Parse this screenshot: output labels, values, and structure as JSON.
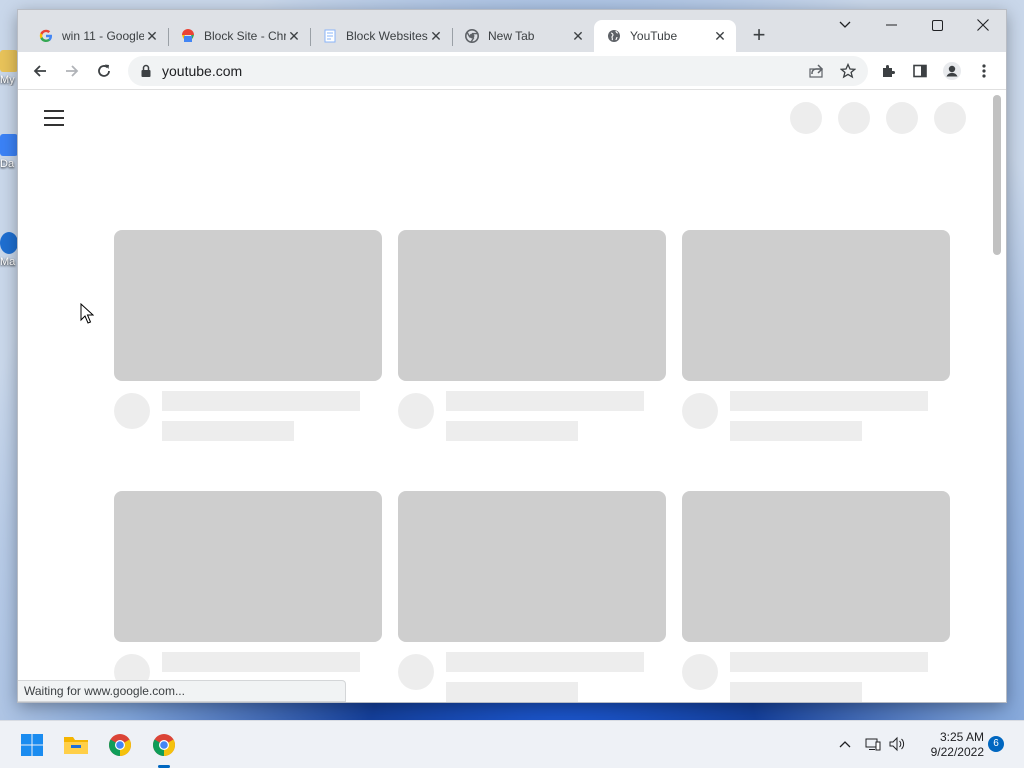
{
  "desktop": {
    "icons": [
      {
        "label": "My",
        "color": "#e8c35a"
      },
      {
        "label": "Da",
        "color": "#3b82f6"
      },
      {
        "label": "Ma",
        "color": "#1f6fd1"
      }
    ]
  },
  "browser": {
    "tabs": [
      {
        "title": "win 11 - Google",
        "icon": "google-icon",
        "active": false
      },
      {
        "title": "Block Site - Chrome",
        "icon": "chrome-webstore-icon",
        "active": false
      },
      {
        "title": "Block Websites",
        "icon": "page-icon",
        "active": false
      },
      {
        "title": "New Tab",
        "icon": "chrome-icon",
        "active": false
      },
      {
        "title": "YouTube",
        "icon": "globe-icon",
        "active": true
      }
    ],
    "new_tab_label": "+",
    "address": {
      "url": "youtube.com"
    },
    "status_text": "Waiting for www.google.com..."
  },
  "page": {
    "skeleton_cards": 6,
    "skeleton_color": "#cecece",
    "placeholder_color": "#ededed"
  },
  "taskbar": {
    "apps": [
      "windows-start-icon",
      "file-explorer-icon",
      "chrome-icon",
      "chrome-icon"
    ],
    "clock": {
      "time": "3:25 AM",
      "date": "9/22/2022"
    },
    "notification_count": "6",
    "accent": "#0067c0"
  }
}
